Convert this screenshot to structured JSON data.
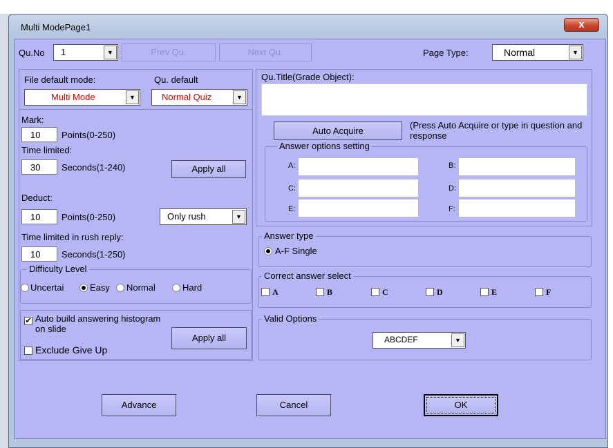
{
  "window": {
    "title": "Multi ModePage1",
    "close_label": "x"
  },
  "toolbar": {
    "quno_label": "Qu.No",
    "quno_value": "1",
    "prev_label": "Prev Qu.",
    "next_label": "Next Qu.",
    "pagetype_label": "Page Type:",
    "pagetype_value": "Normal"
  },
  "left": {
    "file_mode_label": "File default mode:",
    "qu_default_label": "Qu. default",
    "file_mode_value": "Multi Mode",
    "qu_default_value": "Normal Quiz",
    "mark_label": "Mark:",
    "mark_value": "10",
    "mark_unit": "Points(0-250)",
    "time_label": "Time limited:",
    "time_value": "30",
    "time_unit": "Seconds(1-240)",
    "apply_all_label": "Apply all",
    "deduct_label": "Deduct:",
    "deduct_value": "10",
    "deduct_unit": "Points(0-250)",
    "deduct_option": "Only rush",
    "rush_label": "Time limited in rush reply:",
    "rush_value": "10",
    "rush_unit": "Seconds(1-250)",
    "difficulty_legend": "Difficulty Level",
    "difficulty_options": [
      "Uncertai",
      "Easy",
      "Normal",
      "Hard"
    ],
    "difficulty_selected": "Easy",
    "auto_build_label": "Auto build answering histogram on slide",
    "exclude_label": "Exclude Give Up",
    "apply_all2_label": "Apply all"
  },
  "right": {
    "qu_title_label": "Qu.Title(Grade Object):",
    "auto_acquire_label": "Auto Acquire",
    "auto_acquire_hint": "(Press Auto Acquire or type in question and response",
    "answer_options_legend": "Answer options setting",
    "option_labels": [
      "A:",
      "B:",
      "C:",
      "D:",
      "E:",
      "F:"
    ],
    "answer_type_legend": "Answer type",
    "answer_type_value": "A-F Single",
    "correct_legend": "Correct answer select",
    "correct_options": [
      "A",
      "B",
      "C",
      "D",
      "E",
      "F"
    ],
    "valid_legend": "Valid Options",
    "valid_value": "ABCDEF"
  },
  "footer": {
    "advance_label": "Advance",
    "cancel_label": "Cancel",
    "ok_label": "OK"
  }
}
